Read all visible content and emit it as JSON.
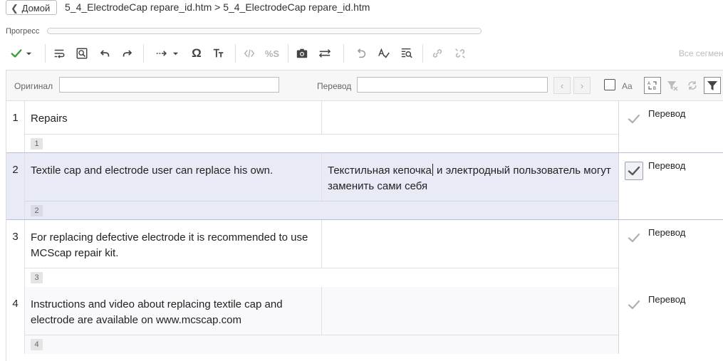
{
  "breadcrumb": {
    "home_label": "Домой",
    "path": "5_4_ElectrodeCap repare_id.htm > 5_4_ElectrodeCap repare_id.htm"
  },
  "progress": {
    "label": "Прогресс",
    "value_percent": 0
  },
  "toolbar": {
    "confirm_color": "#3b9b3b",
    "all_segments_label": "Все сегмент",
    "icons": [
      "confirm-check-icon",
      "dropdown-icon",
      "wrap-text-icon",
      "search-replace-icon",
      "undo-icon",
      "redo-icon",
      "insert-arrow-icon",
      "omega-icon",
      "text-format-icon",
      "code-icon",
      "percent-s-icon",
      "camera-icon",
      "merge-icon",
      "revert-icon",
      "spellcheck-icon",
      "qa-icon",
      "link-icon",
      "unlink-icon"
    ],
    "text_glyphs": {
      "omega": "Ω",
      "percent_s": "%S"
    }
  },
  "filter": {
    "source_label": "Оригинал",
    "source_value": "",
    "target_label": "Перевод",
    "target_value": "",
    "prev_glyph": "‹",
    "next_glyph": "›",
    "case_label": "Aa"
  },
  "segments": [
    {
      "num": "1",
      "source": "Repairs",
      "target": "",
      "status": "Перевод",
      "badge": "1"
    },
    {
      "num": "2",
      "source": "Textile cap and electrode user can replace his own.",
      "target_before_caret": "Текстильная кепочка",
      "target_after_caret": " и электродный пользователь могут заменить сами себя",
      "status": "Перевод",
      "badge": "2"
    },
    {
      "num": "3",
      "source": "For replacing defective electrode it is recommended to use MCScap repair kit.",
      "target": "",
      "status": "Перевод",
      "badge": "3"
    },
    {
      "num": "4",
      "source": "Instructions and video about replacing textile cap and electrode are available on www.mcscap.com",
      "target": "",
      "status": "Перевод",
      "badge": "4"
    }
  ]
}
